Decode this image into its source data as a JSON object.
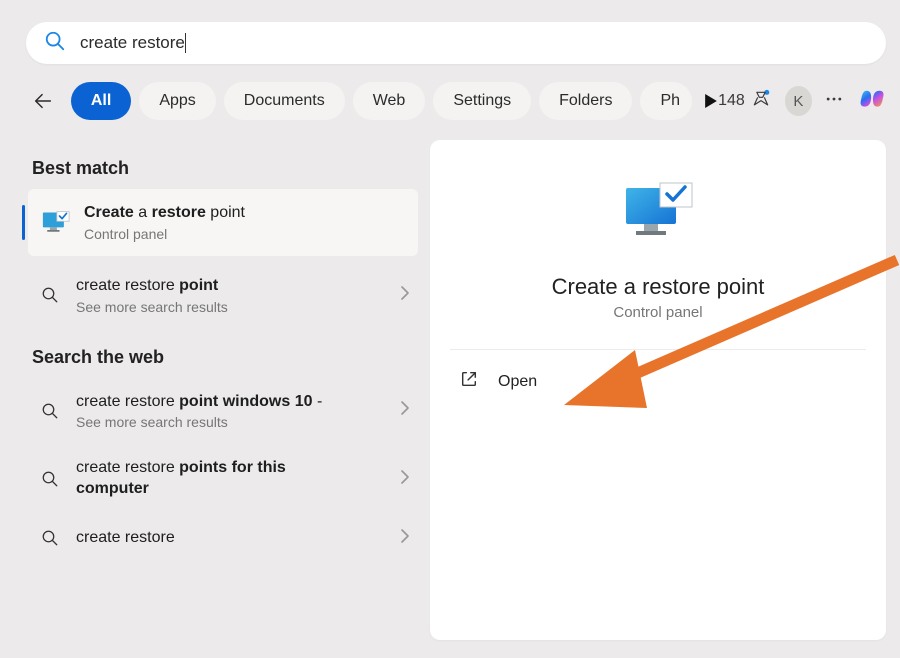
{
  "search": {
    "value": "create restore"
  },
  "tabs": [
    "All",
    "Apps",
    "Documents",
    "Web",
    "Settings",
    "Folders",
    "Ph"
  ],
  "active_tab_index": 0,
  "rewards": {
    "points": "148"
  },
  "avatar_initial": "K",
  "sections": {
    "best_match_hdr": "Best match",
    "search_web_hdr": "Search the web"
  },
  "best_match": {
    "title_parts": {
      "p1": "Create",
      "p2": " a ",
      "p3": "restore",
      "p4": " point"
    },
    "subtitle": "Control panel"
  },
  "under_best": {
    "title_parts": {
      "p1": "create restore ",
      "p2": "point"
    },
    "subtitle": "See more search results"
  },
  "web_results": [
    {
      "line1_plain": "create restore ",
      "line1_bold": "point windows 10",
      "trail": " -",
      "subtitle": "See more search results"
    },
    {
      "line1_plain": "create restore ",
      "line1_bold": "points for this",
      "line2_bold": "computer",
      "subtitle": ""
    },
    {
      "line1_plain": "create restore",
      "line1_bold": "",
      "subtitle": ""
    }
  ],
  "preview": {
    "title": "Create a restore point",
    "subtitle": "Control panel",
    "open_label": "Open"
  },
  "colors": {
    "accent": "#0b63d3",
    "arrow": "#e8742c"
  }
}
